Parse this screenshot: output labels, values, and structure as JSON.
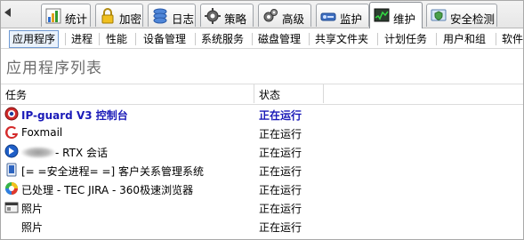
{
  "tabs": [
    {
      "label": "统计",
      "icon": "chart-icon"
    },
    {
      "label": "加密",
      "icon": "padlock-icon"
    },
    {
      "label": "日志",
      "icon": "log-stack-icon"
    },
    {
      "label": "策略",
      "icon": "policy-gear-icon"
    },
    {
      "label": "高级",
      "icon": "advanced-gear-icon"
    },
    {
      "label": "监护",
      "icon": "monitor-icon"
    },
    {
      "label": "维护",
      "icon": "maintenance-icon"
    },
    {
      "label": "安全检测",
      "icon": "security-check-icon"
    }
  ],
  "active_tab": "维护",
  "subtabs": [
    "应用程序",
    "进程",
    "性能",
    "设备管理",
    "系统服务",
    "磁盘管理",
    "共享文件夹",
    "计划任务",
    "用户和组",
    "软件"
  ],
  "active_subtab": "应用程序",
  "page_title": "应用程序列表",
  "columns": {
    "task": "任务",
    "status": "状态"
  },
  "rows": [
    {
      "name": "IP-guard V3 控制台",
      "status": "正在运行",
      "icon": "ipguard-icon",
      "highlight": true
    },
    {
      "name": "Foxmail",
      "status": "正在运行",
      "icon": "foxmail-icon"
    },
    {
      "name": "- RTX 会话",
      "status": "正在运行",
      "icon": "rtx-icon"
    },
    {
      "name": "[= =安全进程= =] 客户关系管理系统",
      "status": "正在运行",
      "icon": "app-window-icon"
    },
    {
      "name": "已处理 - TEC JIRA - 360极速浏览器",
      "status": "正在运行",
      "icon": "browser-360-icon"
    },
    {
      "name": "照片",
      "status": "正在运行",
      "icon": "photo-window-icon"
    },
    {
      "name": "照片",
      "status": "正在运行",
      "icon": "blank-icon"
    }
  ],
  "colors": {
    "highlight": "#1a1ab8",
    "active_border": "#6f9ad3"
  }
}
